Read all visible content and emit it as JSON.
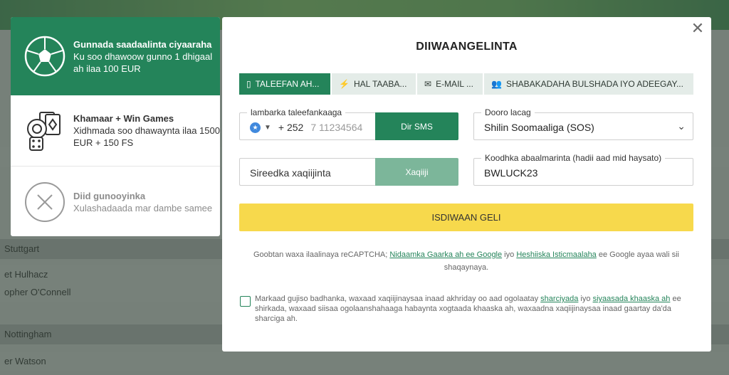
{
  "background": {
    "rows": [
      "Stuttgart",
      "et Hulhacz",
      "opher O'Connell",
      "Nottingham",
      "er Watson"
    ]
  },
  "bonuses": [
    {
      "title": "Gunnada saadaalinta ciyaaraha",
      "desc": "Ku soo dhawoow gunno 1 dhigaal ah ilaa 100 EUR",
      "icon": "soccer-ball-icon"
    },
    {
      "title": "Khamaar + Win Games",
      "desc": "Xidhmada soo dhawaynta ilaa 1500 EUR + 150 FS",
      "icon": "casino-chips-cards-dice-icon"
    },
    {
      "title": "Diid gunooyinka",
      "desc": "Xulashadaada mar dambe samee",
      "icon": "close-circle-icon"
    }
  ],
  "modal": {
    "close_glyph": "✕",
    "title": "DIIWAANGELINTA",
    "tabs": [
      {
        "label": "TALEEFAN AH...",
        "icon": "phone-icon"
      },
      {
        "label": "HAL TAABA...",
        "icon": "lightning-icon"
      },
      {
        "label": "E-MAIL ...",
        "icon": "envelope-icon"
      },
      {
        "label": "SHABAKADAHA BULSHADA IYO ADEEGAY...",
        "icon": "users-icon"
      }
    ],
    "phone": {
      "label": "lambarka taleefankaaga",
      "code": "+ 252",
      "placeholder": "7 11234564"
    },
    "sms_button": "Dir SMS",
    "currency": {
      "label": "Dooro lacag",
      "value": "Shilin Soomaaliga (SOS)"
    },
    "verify": {
      "placeholder": "Sireedka xaqiijinta"
    },
    "verify_button": "Xaqiiji",
    "promo": {
      "label": "Koodhka abaalmarinta (hadii aad mid haysato)",
      "value": "BWLUCK23"
    },
    "submit": "ISDIWAAN GELI",
    "captcha": {
      "pre": "Goobtan waxa ilaalinaya reCAPTCHA; ",
      "link1": "Nidaamka Gaarka ah ee Google",
      "mid": " iyo ",
      "link2": "Heshiiska Isticmaalaha",
      "post": " ee Google ayaa wali sii shaqaynaya."
    },
    "terms": {
      "pre": "Markaad gujiso badhanka, waxaad xaqiijinaysaa inaad akhriday oo aad ogolaatay ",
      "link1": "sharciyada",
      "mid": " iyo ",
      "link2": "siyaasada khaaska ah",
      "post": " ee shirkada, waxaad siisaa ogolaanshahaaga habaynta xogtaada khaaska ah, waxaadna xaqiijinaysaa inaad gaartay da'da sharciga ah."
    }
  }
}
